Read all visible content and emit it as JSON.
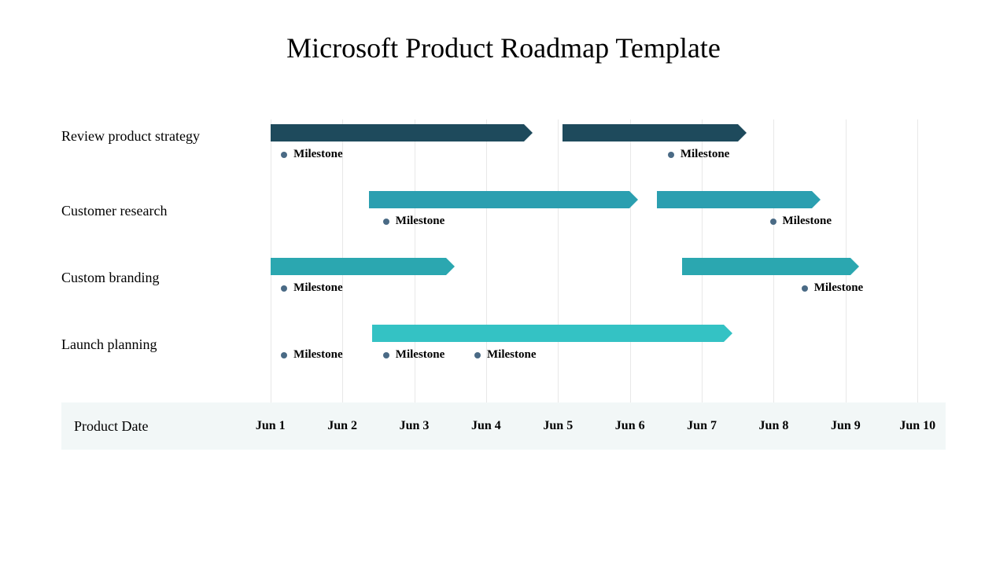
{
  "title": "Microsoft Product Roadmap Template",
  "axis_title": "Product Date",
  "dates": [
    "Jun 1",
    "Jun 2",
    "Jun 3",
    "Jun 4",
    "Jun 5",
    "Jun 6",
    "Jun 7",
    "Jun 8",
    "Jun 9",
    "Jun 10"
  ],
  "rows": [
    {
      "label": "Review product strategy"
    },
    {
      "label": "Customer research"
    },
    {
      "label": "Custom branding"
    },
    {
      "label": "Launch planning"
    }
  ],
  "milestone_label": "Milestone",
  "colors": {
    "bar1": "#1e4a5c",
    "bar2": "#2b9fb0",
    "bar3": "#2ba7b0",
    "bar4": "#34c2c4",
    "dot": "#4a6a85"
  },
  "chart_data": {
    "type": "bar",
    "title": "Microsoft Product Roadmap Template",
    "xlabel": "Product Date",
    "ylabel": "",
    "x_categories": [
      "Jun 1",
      "Jun 2",
      "Jun 3",
      "Jun 4",
      "Jun 5",
      "Jun 6",
      "Jun 7",
      "Jun 8",
      "Jun 9",
      "Jun 10"
    ],
    "series": [
      {
        "name": "Review product strategy",
        "bars": [
          {
            "start": "Jun 1",
            "end": "Jun 4.5",
            "color": "#1e4a5c"
          },
          {
            "start": "Jun 5",
            "end": "Jun 7.5",
            "color": "#1e4a5c"
          }
        ],
        "milestones": [
          "Jun 1",
          "Jun 6.5"
        ]
      },
      {
        "name": "Customer research",
        "bars": [
          {
            "start": "Jun 2.5",
            "end": "Jun 6",
            "color": "#2b9fb0"
          },
          {
            "start": "Jun 6.5",
            "end": "Jun 8.5",
            "color": "#2b9fb0"
          }
        ],
        "milestones": [
          "Jun 2.5",
          "Jun 8"
        ]
      },
      {
        "name": "Custom branding",
        "bars": [
          {
            "start": "Jun 1",
            "end": "Jun 3.5",
            "color": "#2ba7b0"
          },
          {
            "start": "Jun 6.8",
            "end": "Jun 9",
            "color": "#2ba7b0"
          }
        ],
        "milestones": [
          "Jun 1",
          "Jun 8.5"
        ]
      },
      {
        "name": "Launch planning",
        "bars": [
          {
            "start": "Jun 2.5",
            "end": "Jun 7.3",
            "color": "#34c2c4"
          }
        ],
        "milestones": [
          "Jun 1",
          "Jun 2.5",
          "Jun 3.7"
        ]
      }
    ],
    "xlim": [
      "Jun 1",
      "Jun 10"
    ]
  }
}
